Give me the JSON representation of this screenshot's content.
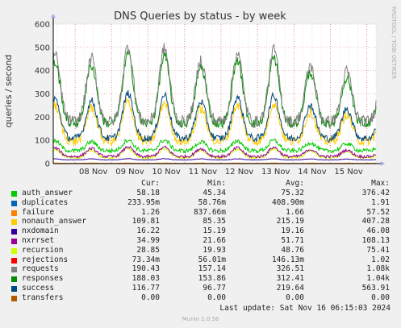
{
  "chart_data": {
    "type": "line",
    "title": "DNS Queries by status - by week",
    "ylabel": "queries / second",
    "side_label": "RRDTOOL / TOBI OETIKER",
    "ylim": [
      0,
      600
    ],
    "yticks": [
      0,
      100,
      200,
      300,
      400,
      500,
      600
    ],
    "xticks": [
      "08 Nov",
      "09 Nov",
      "10 Nov",
      "11 Nov",
      "12 Nov",
      "13 Nov",
      "14 Nov",
      "15 Nov"
    ],
    "x_range_days": [
      7.4,
      16.25
    ],
    "series": [
      {
        "name": "auth_answer",
        "color": "#00cc00",
        "mean": 75.32,
        "min": 45.34,
        "max": 376.42
      },
      {
        "name": "duplicates",
        "color": "#0066b3",
        "mean": 0.4089,
        "min": 0.05876,
        "max": 1.91
      },
      {
        "name": "failure",
        "color": "#ff8000",
        "mean": 1.66,
        "min": 0.83766,
        "max": 57.52
      },
      {
        "name": "nonauth_answer",
        "color": "#ffcc00",
        "mean": 215.19,
        "min": 85.35,
        "max": 407.28
      },
      {
        "name": "nxdomain",
        "color": "#330099",
        "mean": 19.16,
        "min": 15.19,
        "max": 46.08
      },
      {
        "name": "nxrrset",
        "color": "#990099",
        "mean": 51.71,
        "min": 21.66,
        "max": 108.13
      },
      {
        "name": "recursion",
        "color": "#ccff00",
        "mean": 48.76,
        "min": 19.93,
        "max": 75.41
      },
      {
        "name": "rejections",
        "color": "#ff0000",
        "mean": 0.14613,
        "min": 0.05601,
        "max": 1.02
      },
      {
        "name": "requests",
        "color": "#808080",
        "mean": 326.51,
        "min": 157.14,
        "max": 1080
      },
      {
        "name": "responses",
        "color": "#008f00",
        "mean": 312.41,
        "min": 153.86,
        "max": 1040
      },
      {
        "name": "success",
        "color": "#00487d",
        "mean": 219.64,
        "min": 96.77,
        "max": 563.91
      },
      {
        "name": "transfers",
        "color": "#b35a00",
        "mean": 0,
        "min": 0,
        "max": 0
      }
    ]
  },
  "legend": {
    "headers": {
      "cur": "Cur:",
      "min": "Min:",
      "avg": "Avg:",
      "max": "Max:"
    },
    "rows": [
      {
        "name": "auth_answer",
        "color": "#00cc00",
        "cur": "58.18",
        "min": "45.34",
        "avg": "75.32",
        "max": "376.42"
      },
      {
        "name": "duplicates",
        "color": "#0066b3",
        "cur": "233.95m",
        "min": "58.76m",
        "avg": "408.90m",
        "max": "1.91"
      },
      {
        "name": "failure",
        "color": "#ff8000",
        "cur": "1.26",
        "min": "837.66m",
        "avg": "1.66",
        "max": "57.52"
      },
      {
        "name": "nonauth_answer",
        "color": "#ffcc00",
        "cur": "109.81",
        "min": "85.35",
        "avg": "215.19",
        "max": "407.28"
      },
      {
        "name": "nxdomain",
        "color": "#330099",
        "cur": "16.22",
        "min": "15.19",
        "avg": "19.16",
        "max": "46.08"
      },
      {
        "name": "nxrrset",
        "color": "#990099",
        "cur": "34.99",
        "min": "21.66",
        "avg": "51.71",
        "max": "108.13"
      },
      {
        "name": "recursion",
        "color": "#ccff00",
        "cur": "28.85",
        "min": "19.93",
        "avg": "48.76",
        "max": "75.41"
      },
      {
        "name": "rejections",
        "color": "#ff0000",
        "cur": "73.34m",
        "min": "56.01m",
        "avg": "146.13m",
        "max": "1.02"
      },
      {
        "name": "requests",
        "color": "#808080",
        "cur": "190.43",
        "min": "157.14",
        "avg": "326.51",
        "max": "1.08k"
      },
      {
        "name": "responses",
        "color": "#008f00",
        "cur": "188.03",
        "min": "153.86",
        "avg": "312.41",
        "max": "1.04k"
      },
      {
        "name": "success",
        "color": "#00487d",
        "cur": "116.77",
        "min": "96.77",
        "avg": "219.64",
        "max": "563.91"
      },
      {
        "name": "transfers",
        "color": "#b35a00",
        "cur": "0.00",
        "min": "0.00",
        "avg": "0.00",
        "max": "0.00"
      }
    ]
  },
  "last_update": "Last update: Sat Nov 16 06:15:03 2024",
  "footer": "Munin 2.0.56"
}
